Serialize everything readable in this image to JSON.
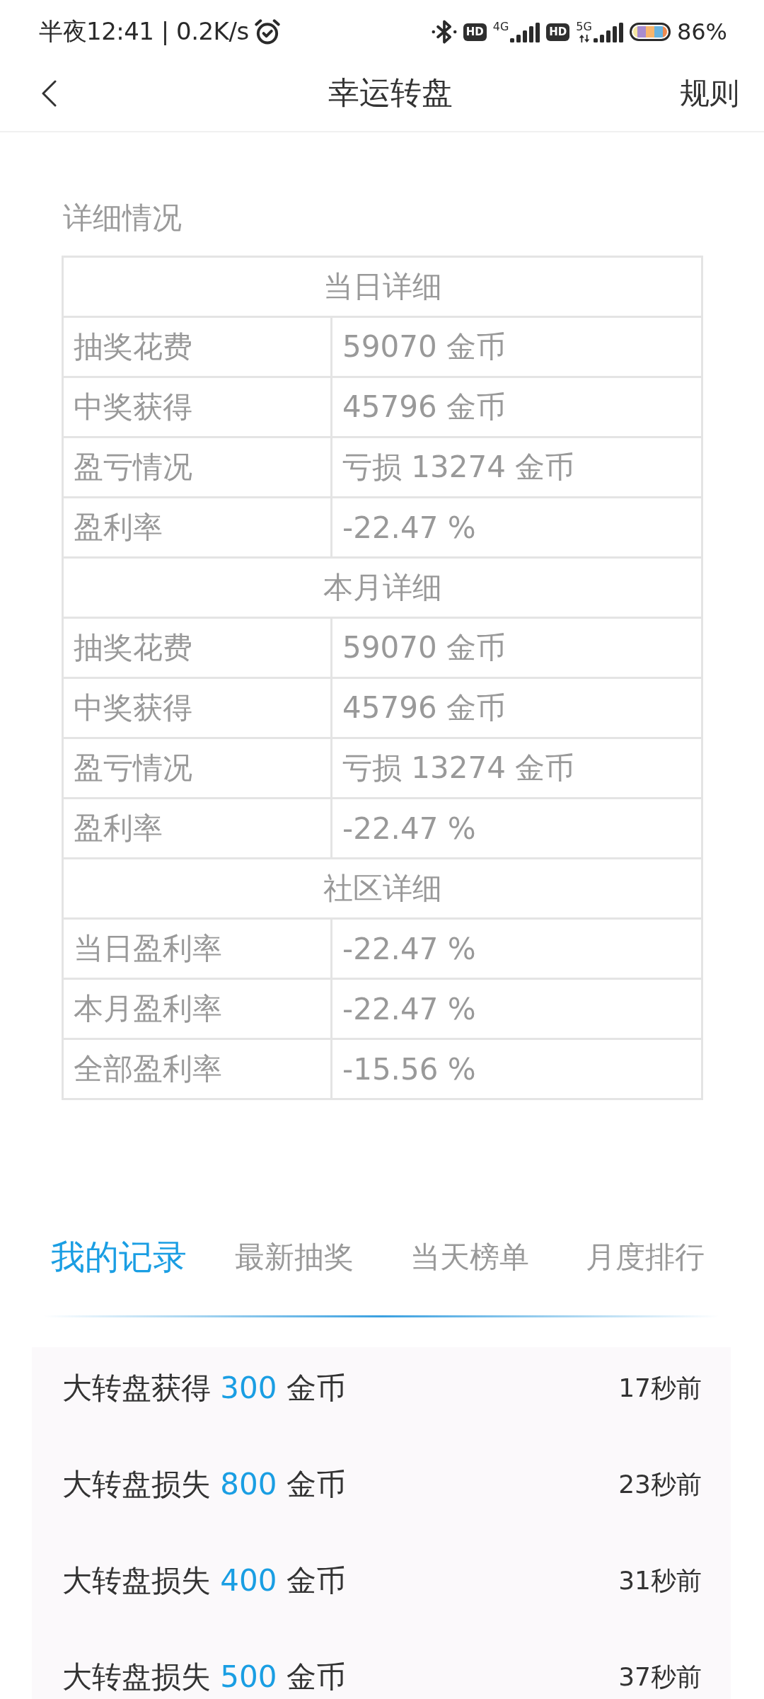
{
  "status_bar": {
    "time_and_speed": "半夜12:41 | 0.2K/s",
    "sims": [
      {
        "hd": "HD",
        "network": "4G",
        "activity": false
      },
      {
        "hd": "HD",
        "network": "5G",
        "activity": true
      }
    ],
    "battery": "86%"
  },
  "header": {
    "title": "幸运转盘",
    "rules_link": "规则"
  },
  "details": {
    "title": "详细情况",
    "sections": [
      {
        "heading": "当日详细",
        "rows": [
          {
            "label": "抽奖花费",
            "value": "59070 金币"
          },
          {
            "label": "中奖获得",
            "value": "45796 金币"
          },
          {
            "label": "盈亏情况",
            "value": "亏损 13274 金币"
          },
          {
            "label": "盈利率",
            "value": "-22.47 %"
          }
        ]
      },
      {
        "heading": "本月详细",
        "rows": [
          {
            "label": "抽奖花费",
            "value": "59070 金币"
          },
          {
            "label": "中奖获得",
            "value": "45796 金币"
          },
          {
            "label": "盈亏情况",
            "value": "亏损 13274 金币"
          },
          {
            "label": "盈利率",
            "value": "-22.47 %"
          }
        ]
      },
      {
        "heading": "社区详细",
        "rows": [
          {
            "label": "当日盈利率",
            "value": "-22.47 %"
          },
          {
            "label": "本月盈利率",
            "value": "-22.47 %"
          },
          {
            "label": "全部盈利率",
            "value": "-15.56 %"
          }
        ]
      }
    ]
  },
  "tabs": [
    {
      "label": "我的记录",
      "selected": true
    },
    {
      "label": "最新抽奖",
      "selected": false
    },
    {
      "label": "当天榜单",
      "selected": false
    },
    {
      "label": "月度排行",
      "selected": false
    }
  ],
  "records": [
    {
      "action": "大转盘获得",
      "amount": "300",
      "unit": "金币",
      "time": "17秒前"
    },
    {
      "action": "大转盘损失",
      "amount": "800",
      "unit": "金币",
      "time": "23秒前"
    },
    {
      "action": "大转盘损失",
      "amount": "400",
      "unit": "金币",
      "time": "31秒前"
    },
    {
      "action": "大转盘损失",
      "amount": "500",
      "unit": "金币",
      "time": "37秒前"
    }
  ]
}
